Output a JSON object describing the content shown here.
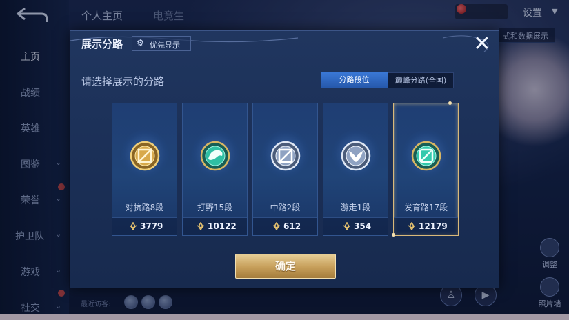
{
  "background": {
    "sidebar": {
      "back_icon": "back-arrow-icon",
      "items": [
        {
          "label": "主页",
          "active": true,
          "chevron": false
        },
        {
          "label": "战绩",
          "active": false,
          "chevron": false
        },
        {
          "label": "英雄",
          "active": false,
          "chevron": false
        },
        {
          "label": "图鉴",
          "active": false,
          "chevron": true
        },
        {
          "label": "荣誉",
          "active": false,
          "chevron": true
        },
        {
          "label": "护卫队",
          "active": false,
          "chevron": true
        },
        {
          "label": "游戏",
          "active": false,
          "chevron": true
        },
        {
          "label": "社交",
          "active": false,
          "chevron": true
        }
      ]
    },
    "top_tabs": [
      "个人主页",
      "电竞生"
    ],
    "settings_label": "设置",
    "data_display_label": "式和数据展示",
    "right_buttons": [
      "调整",
      "照片墙"
    ],
    "recent_visitors_label": "最近访客:"
  },
  "modal": {
    "title": "展示分路",
    "priority_button": "优先显示",
    "close_icon": "close-icon",
    "subtitle": "请选择展示的分路",
    "segments": [
      {
        "label": "分路段位",
        "active": true
      },
      {
        "label": "巅峰分路(全国)",
        "active": false
      }
    ],
    "lanes": [
      {
        "name": "对抗路8段",
        "points": "3779",
        "icon": "clash-lane-icon",
        "selected": false,
        "badge_color": "#d9a84c"
      },
      {
        "name": "打野15段",
        "points": "10122",
        "icon": "jungle-dragon-icon",
        "selected": false,
        "badge_color": "#2fbfa4"
      },
      {
        "name": "中路2段",
        "points": "612",
        "icon": "mid-lane-icon",
        "selected": false,
        "badge_color": "#b9c7dd"
      },
      {
        "name": "游走1段",
        "points": "354",
        "icon": "roam-wings-icon",
        "selected": false,
        "badge_color": "#aebdd6"
      },
      {
        "name": "发育路17段",
        "points": "12179",
        "icon": "farm-lane-icon",
        "selected": true,
        "badge_color": "#33c9ad"
      }
    ],
    "points_icon": "lane-points-icon",
    "confirm_label": "确定",
    "colors": {
      "accent_gold": "#c69e59",
      "selected_border": "#d9b97a",
      "segment_active": "#3a78d6"
    }
  }
}
